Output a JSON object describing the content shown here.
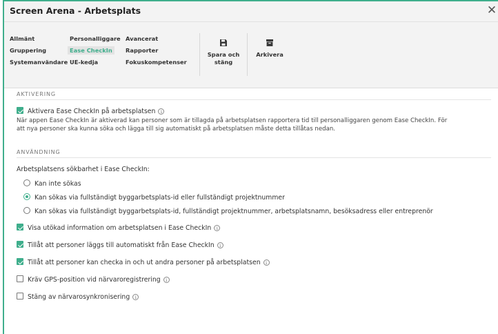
{
  "window": {
    "title": "Screen Arena - Arbetsplats",
    "close_glyph": "✕"
  },
  "ribbon": {
    "nav": [
      [
        "Allmänt",
        "Personalliggare",
        "Avancerat"
      ],
      [
        "Gruppering",
        "Ease CheckIn",
        "Rapporter"
      ],
      [
        "Systemanvändare",
        "UE-kedja",
        "Fokuskompetenser"
      ]
    ],
    "active": "Ease CheckIn",
    "save_line1": "Spara och",
    "save_line2": "stäng",
    "archive": "Arkivera"
  },
  "activation": {
    "heading": "AKTIVERING",
    "checkbox_label": "Aktivera Ease CheckIn på arbetsplatsen",
    "checked": true,
    "description_line1": "När appen Ease CheckIn är aktiverad kan personer som är tillagda på arbetsplatsen rapportera tid till personalliggaren genom Ease CheckIn. För",
    "description_line2": "att nya personer ska kunna söka och lägga till sig automatiskt på arbetsplatsen måste detta tillåtas nedan."
  },
  "usage": {
    "heading": "ANVÄNDNING",
    "searchability_label": "Arbetsplatsens sökbarhet i Ease CheckIn:",
    "radios": [
      {
        "label": "Kan inte sökas",
        "selected": false
      },
      {
        "label": "Kan sökas via fullständigt byggarbetsplats-id eller fullständigt projektnummer",
        "selected": true
      },
      {
        "label": "Kan sökas via fullständigt byggarbetsplats-id, fullständigt projektnummer, arbetsplatsnamn, besöksadress eller entreprenör",
        "selected": false
      }
    ],
    "options": [
      {
        "label": "Visa utökad information om arbetsplatsen i Ease CheckIn",
        "checked": true
      },
      {
        "label": "Tillåt att personer läggs till automatiskt från Ease CheckIn",
        "checked": true
      },
      {
        "label": "Tillåt att personer kan checka in och ut andra personer på arbetsplatsen",
        "checked": true
      },
      {
        "label": "Kräv GPS-position vid närvaroregistrering",
        "checked": false
      },
      {
        "label": "Stäng av närvarosynkronisering",
        "checked": false
      }
    ]
  },
  "colors": {
    "accent": "#3fae8c",
    "ribbon_bg": "#f3f3f3"
  },
  "icons": {
    "save": "floppy-disk-icon",
    "archive": "archive-box-icon",
    "info": "info-icon",
    "close": "close-icon"
  }
}
